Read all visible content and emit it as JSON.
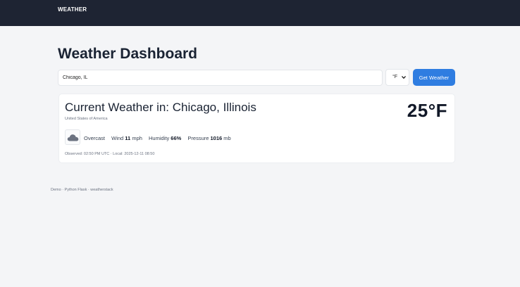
{
  "nav": {
    "brand": "WEATHER"
  },
  "page": {
    "title": "Weather Dashboard"
  },
  "search": {
    "value": "Chicago, IL",
    "unit_selected": "°F",
    "button_label": "Get Weather"
  },
  "current": {
    "title_prefix": "Current Weather in:",
    "location": "Chicago, Illinois",
    "country": "United States of America",
    "temperature": "25°F",
    "condition": "Overcast",
    "condition_icon": "cloud-icon",
    "wind_label": "Wind",
    "wind_value": "11",
    "wind_unit": "mph",
    "humidity_label": "Humidity",
    "humidity_value": "66%",
    "pressure_label": "Pressure",
    "pressure_value": "1016",
    "pressure_unit": "mb",
    "observed": "Observed: 02:50 PM UTC · Local: 2025-12-11 08:50"
  },
  "footer": {
    "text": "Demo · Python Flask · weatherstack"
  },
  "colors": {
    "topbar": "#1e2433",
    "accent": "#2f7de1",
    "background": "#f4f5f7"
  }
}
